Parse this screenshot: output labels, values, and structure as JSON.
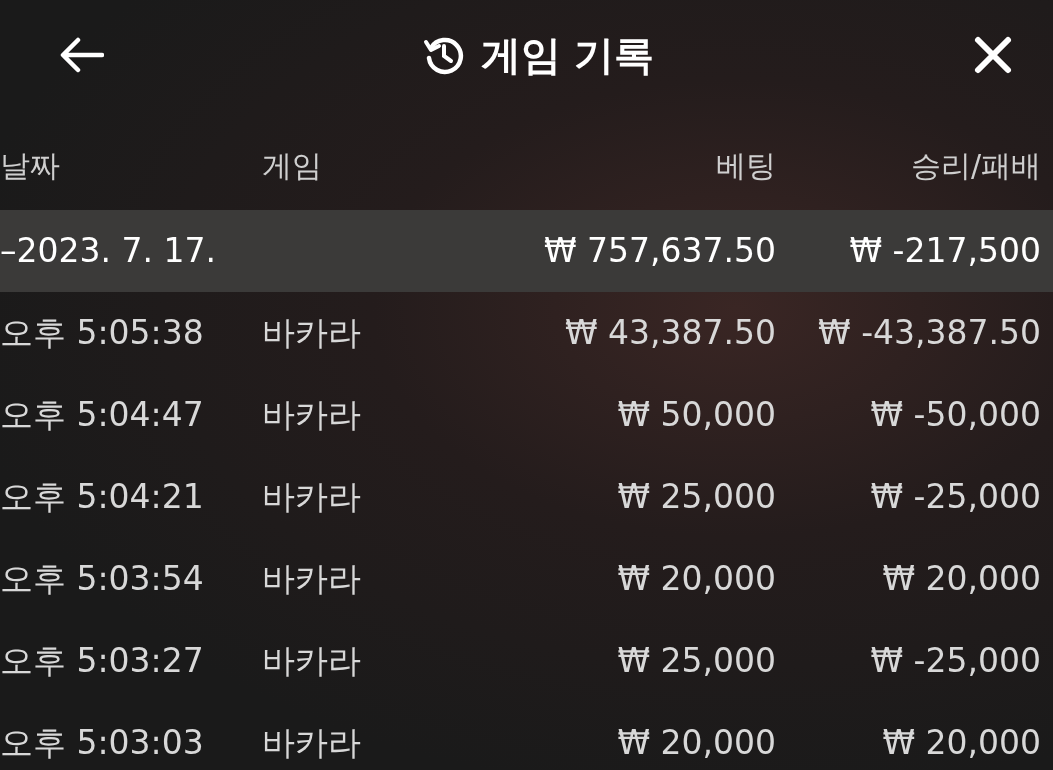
{
  "header": {
    "title": "게임 기록"
  },
  "table": {
    "columns": [
      "날짜",
      "게임",
      "베팅",
      "승리/패배"
    ],
    "summary": {
      "date": "–2023. 7. 17.",
      "bet": "₩ 757,637.50",
      "result": "₩ -217,500"
    },
    "rows": [
      {
        "time": "오후 5:05:38",
        "game": "바카라",
        "bet": "₩ 43,387.50",
        "result": "₩ -43,387.50"
      },
      {
        "time": "오후 5:04:47",
        "game": "바카라",
        "bet": "₩ 50,000",
        "result": "₩ -50,000"
      },
      {
        "time": "오후 5:04:21",
        "game": "바카라",
        "bet": "₩ 25,000",
        "result": "₩ -25,000"
      },
      {
        "time": "오후 5:03:54",
        "game": "바카라",
        "bet": "₩ 20,000",
        "result": "₩ 20,000"
      },
      {
        "time": "오후 5:03:27",
        "game": "바카라",
        "bet": "₩ 25,000",
        "result": "₩ -25,000"
      },
      {
        "time": "오후 5:03:03",
        "game": "바카라",
        "bet": "₩ 20,000",
        "result": "₩ 20,000"
      }
    ]
  }
}
